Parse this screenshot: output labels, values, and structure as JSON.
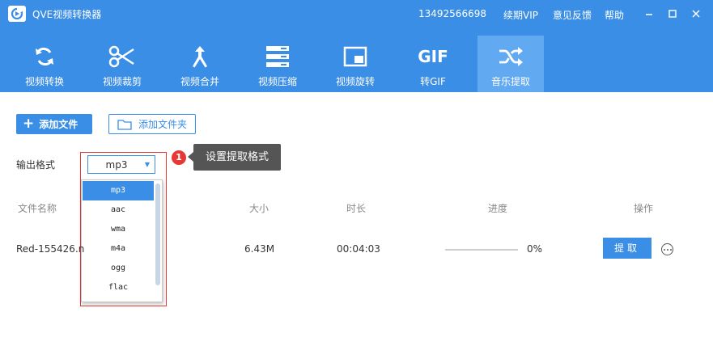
{
  "app": {
    "title": "QVE视频转换器"
  },
  "titlebar": {
    "phone": "13492566698",
    "vip": "续期VIP",
    "feedback": "意见反馈",
    "help": "帮助"
  },
  "toolbar": {
    "items": [
      {
        "label": "视频转换",
        "icon": "refresh-icon"
      },
      {
        "label": "视频裁剪",
        "icon": "scissors-icon"
      },
      {
        "label": "视频合并",
        "icon": "merge-icon"
      },
      {
        "label": "视频压缩",
        "icon": "compress-icon"
      },
      {
        "label": "视频旋转",
        "icon": "rotate-icon"
      },
      {
        "label": "转GIF",
        "icon": "gif-icon",
        "icon_text": "GIF"
      },
      {
        "label": "音乐提取",
        "icon": "shuffle-icon",
        "active": true
      }
    ]
  },
  "actions": {
    "add_file": "添加文件",
    "add_folder": "添加文件夹"
  },
  "format": {
    "label": "输出格式",
    "selected": "mp3",
    "options": [
      "mp3",
      "aac",
      "wma",
      "m4a",
      "ogg",
      "flac"
    ]
  },
  "tooltip": {
    "step": "1",
    "text": "设置提取格式"
  },
  "table": {
    "headers": {
      "name": "文件名称",
      "size": "大小",
      "duration": "时长",
      "progress": "进度",
      "actions": "操作"
    },
    "rows": [
      {
        "name": "Red-155426.n",
        "size": "6.43M",
        "duration": "00:04:03",
        "progress_text": "0%",
        "progress": 0,
        "action": "提取"
      }
    ]
  },
  "colors": {
    "accent": "#3a8ee6",
    "active_tab": "#61a9f0",
    "highlight": "#e53935"
  }
}
